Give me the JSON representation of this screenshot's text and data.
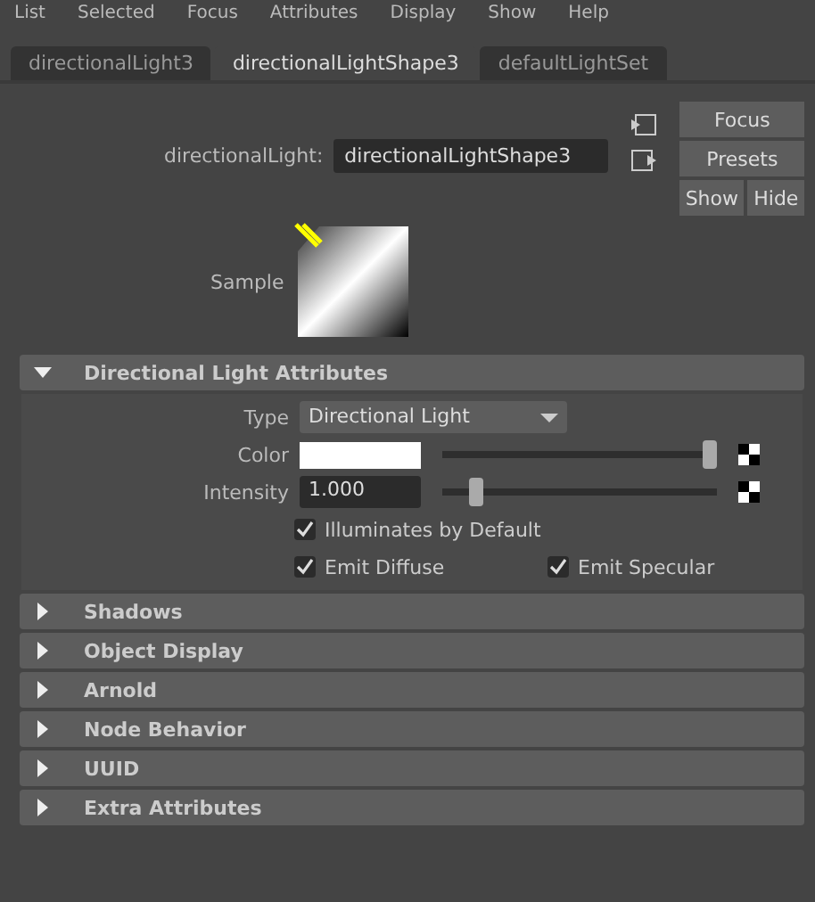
{
  "menu": [
    "List",
    "Selected",
    "Focus",
    "Attributes",
    "Display",
    "Show",
    "Help"
  ],
  "tabs": [
    {
      "label": "directionalLight3",
      "selected": false
    },
    {
      "label": "directionalLightShape3",
      "selected": true
    },
    {
      "label": "defaultLightSet",
      "selected": false
    }
  ],
  "node": {
    "label": "directionalLight:",
    "value": "directionalLightShape3"
  },
  "buttons": [
    "Focus",
    "Presets",
    "Show",
    "Hide"
  ],
  "sample": {
    "label": "Sample"
  },
  "sections": [
    {
      "title": "Directional Light Attributes",
      "expanded": true,
      "attributes": [
        {
          "kind": "dropdown",
          "label": "Type",
          "value": "Directional Light"
        },
        {
          "kind": "color",
          "label": "Color",
          "level": 1
        },
        {
          "kind": "number",
          "label": "Intensity",
          "value": "1.000",
          "level": 0.1
        }
      ],
      "checkbox_rows": [
        [
          {
            "label": "Illuminates by Default",
            "checked": true
          }
        ],
        [
          {
            "label": "Emit Diffuse",
            "checked": true
          },
          {
            "label": "Emit Specular",
            "checked": true
          }
        ]
      ]
    },
    {
      "title": "Shadows",
      "expanded": false
    },
    {
      "title": "Object Display",
      "expanded": false
    },
    {
      "title": "Arnold",
      "expanded": false
    },
    {
      "title": "Node Behavior",
      "expanded": false
    },
    {
      "title": "UUID",
      "expanded": false
    },
    {
      "title": "Extra Attributes",
      "expanded": false
    }
  ]
}
